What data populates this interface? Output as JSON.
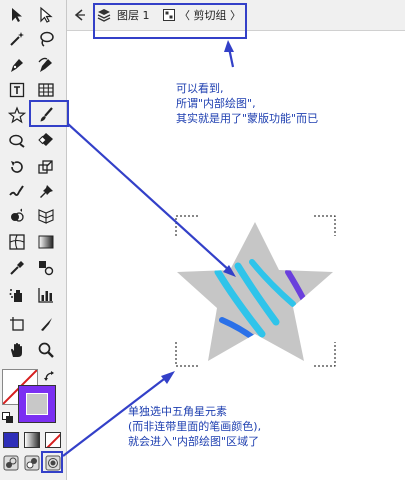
{
  "breadcrumb": {
    "layer_label": "图层 1",
    "group_label": "〈 剪切组 〉"
  },
  "annotations": {
    "top_lines": [
      "可以看到,",
      "所谓\"内部绘图\",",
      "其实就是用了\"蒙版功能\"而已"
    ],
    "bottom_lines": [
      "单独选中五角星元素",
      "(而非连带里面的笔画颜色),",
      "就会进入\"内部绘图\"区域了"
    ]
  },
  "colors": {
    "annotation": "#1e3fb0",
    "highlight": "#3340c8",
    "star_fill": "#c6c6c6",
    "stroke_cyan": "#2fc4ea",
    "stroke_purple": "#6a3fdc",
    "stroke_blue": "#2a70e8"
  },
  "tools": [
    {
      "name": "selection-tool-icon"
    },
    {
      "name": "direct-selection-tool-icon"
    },
    {
      "name": "magic-wand-tool-icon"
    },
    {
      "name": "lasso-tool-icon"
    },
    {
      "name": "pen-tool-icon"
    },
    {
      "name": "curvature-tool-icon"
    },
    {
      "name": "type-tool-icon"
    },
    {
      "name": "grid-tool-icon"
    },
    {
      "name": "star-tool-icon"
    },
    {
      "name": "paintbrush-tool-icon"
    },
    {
      "name": "blob-brush-tool-icon"
    },
    {
      "name": "eraser-tool-icon"
    },
    {
      "name": "rotate-tool-icon"
    },
    {
      "name": "scale-tool-icon"
    },
    {
      "name": "warp-tool-icon"
    },
    {
      "name": "pin-tool-icon"
    },
    {
      "name": "shape-builder-tool-icon"
    },
    {
      "name": "perspective-grid-tool-icon"
    },
    {
      "name": "mesh-tool-icon"
    },
    {
      "name": "gradient-tool-icon"
    },
    {
      "name": "eyedropper-tool-icon"
    },
    {
      "name": "blend-tool-icon"
    },
    {
      "name": "symbol-sprayer-tool-icon"
    },
    {
      "name": "column-graph-tool-icon"
    },
    {
      "name": "artboard-tool-icon"
    },
    {
      "name": "slice-tool-icon"
    },
    {
      "name": "hand-tool-icon"
    },
    {
      "name": "zoom-tool-icon"
    }
  ]
}
